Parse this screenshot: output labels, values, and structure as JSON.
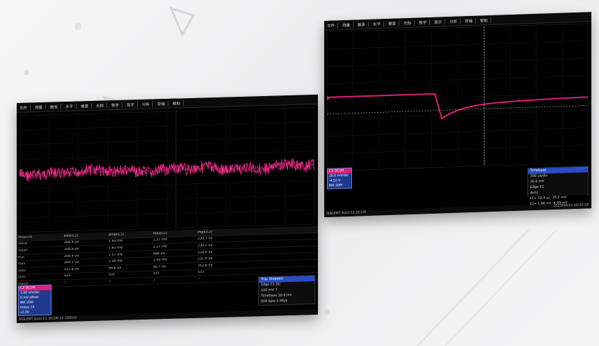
{
  "colors": {
    "trace": "#e01e7c",
    "trace_light": "#ff4fa8",
    "background": "#000000",
    "accent_blue": "#2a4cc8",
    "pass": "#3ad04a"
  },
  "left_scope": {
    "toolbar": [
      "文件",
      "测量",
      "触发",
      "水平",
      "垂直",
      "光标",
      "数学",
      "显示",
      "分析",
      "存储",
      "帮助"
    ],
    "table": {
      "headers": [
        "Measure",
        "Rms(C2)",
        "Ampl(C2)",
        "Max(C2)",
        "Pkpk(C2)"
      ],
      "rows": [
        [
          "value",
          "208.8 uV",
          "1.63 mV",
          "1.27 mV",
          "230.7 uV"
        ],
        [
          "mean",
          "208.8 uV",
          "1.63 mV",
          "1.27 mV",
          "230.2 uV"
        ],
        [
          "min",
          "208.4 uV",
          "1.57 mV",
          "886 uV",
          "228.0 uV"
        ],
        [
          "max",
          "209.1 uV",
          "2.04 mV",
          "1.63 mV",
          "231.9 uV"
        ],
        [
          "sdev",
          "152.8 nV",
          "99.6 uV",
          "90.7 uV",
          "762.8 nV"
        ],
        [
          "num",
          "533",
          "532",
          "532",
          "533"
        ],
        [
          "status",
          "✓",
          "✓",
          "✓",
          "✓"
        ]
      ]
    },
    "channel_box": [
      "C2 DC1M",
      "1.00 mV/div",
      "0 mV offset",
      "BW 20M",
      "Probe 1X",
      "x1.00"
    ],
    "trigger_box": [
      "Trig: Stopped",
      "Edge  C1  DC",
      "100 mV  ↑",
      "Timebase 10.0 ms",
      "500 kpts 5 MS/s"
    ],
    "status_bar": "SIGLENT Auto    C1 DC1M 1X 200mV"
  },
  "right_scope": {
    "toolbar": [
      "文件",
      "测量",
      "触发",
      "水平",
      "垂直",
      "光标",
      "数学",
      "显示",
      "分析",
      "存储",
      "帮助"
    ],
    "channel_box": [
      "C2 DC1M",
      "20.0 mV/div",
      "-4.52 V",
      "BW 20M"
    ],
    "trigger_box": [
      "Timebase",
      "200 us/div",
      "20.0 mV",
      "Edge  C1",
      "Auto"
    ],
    "cursor_lines": [
      "X1= 10.4 us  -35.2 mV",
      "X2= 1.86 ms  -4.99 mV"
    ],
    "status_bar": "SIGLENT Auto    C1 DC1M",
    "footer": "2023/04/13 10:32:18"
  }
}
